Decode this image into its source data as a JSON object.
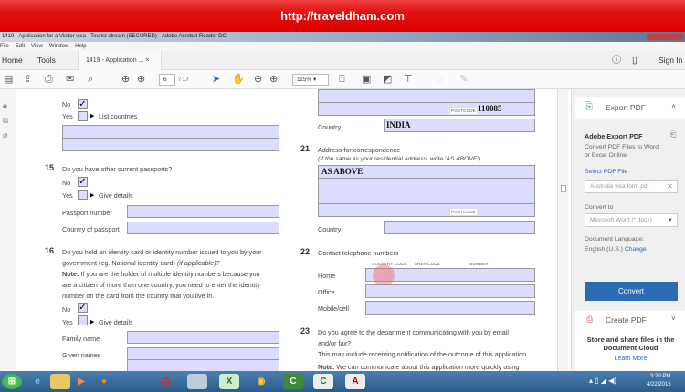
{
  "banner": {
    "url": "http://traveldham.com"
  },
  "window": {
    "title": "1419 - Application for a Visitor visa - Tourist stream (SECURED) - Adobe Acrobat Reader DC"
  },
  "menu": [
    "File",
    "Edit",
    "View",
    "Window",
    "Help"
  ],
  "tabs": {
    "home": "Home",
    "tools": "Tools",
    "doc": "1419 - Application ...",
    "close": "×",
    "sign_in": "Sign In"
  },
  "toolbar": {
    "page": "6",
    "page_total": "/ 17",
    "zoom": "115%"
  },
  "form": {
    "q14": {
      "no": "No",
      "yes": "Yes",
      "list": "List countries"
    },
    "q15": {
      "num": "15",
      "question": "Do you have other current passports?",
      "no": "No",
      "yes": "Yes",
      "give": "Give details",
      "passport_number": "Passport number",
      "country_of_passport": "Country of passport"
    },
    "q16": {
      "num": "16",
      "question1": "Do you hold an identity card or identity number issued to you by your",
      "question2": "government (eg. National identity card)",
      "question2_italic": "(if applicable)?",
      "note_label": "Note:",
      "note1": " If you are the holder of multiple identity numbers because you",
      "note2": "are a citizen of more than one country, you need to enter the identity",
      "note3": "number on the card from the country that you live in.",
      "no": "No",
      "yes": "Yes",
      "give": "Give details",
      "family_name": "Family name",
      "given_names": "Given names"
    },
    "postcode_label": "POSTCODE",
    "postcode_value": "110085",
    "country_label": "Country",
    "country_value": "INDIA",
    "q21": {
      "num": "21",
      "title": "Address for correspondence",
      "hint": "(If the same as your residential address, write 'AS ABOVE')",
      "value": "AS ABOVE",
      "postcode": "POSTCODE",
      "country": "Country"
    },
    "q22": {
      "num": "22",
      "title": "Contact telephone numbers",
      "country_code": "COUNTRY CODE",
      "area_code": "AREA CODE",
      "number": "NUMBER",
      "home": "Home",
      "office": "Office",
      "mobile": "Mobile/cell"
    },
    "q23": {
      "num": "23",
      "line1": "Do you agree to the department communicating with you by email",
      "line2": "and/or fax?",
      "line3": "This may include receiving notification of the outcome of this application.",
      "note_label": "Note:",
      "note": " We can communicate about this application more quickly using"
    }
  },
  "panel": {
    "export_title": "Export PDF",
    "heading": "Adobe Export PDF",
    "desc1": "Convert PDF Files to Word",
    "desc2": "or Excel Online",
    "select_label": "Select PDF File",
    "file": "Australia visa form.pdf",
    "convert_to": "Convert to",
    "format": "Microsoft Word (*.docx)",
    "lang_label": "Document Language:",
    "lang": "English (U.S.)",
    "change": "Change",
    "convert": "Convert",
    "create": "Create PDF",
    "cloud1": "Store and share files in the",
    "cloud2": "Document Cloud",
    "learn": "Learn More"
  },
  "taskbar": {
    "time": "3:20 PM",
    "date": "4/22/2016"
  },
  "colors": {
    "field": "#dcdcff",
    "accent": "#2d6bb5",
    "banner": "#e01010"
  }
}
